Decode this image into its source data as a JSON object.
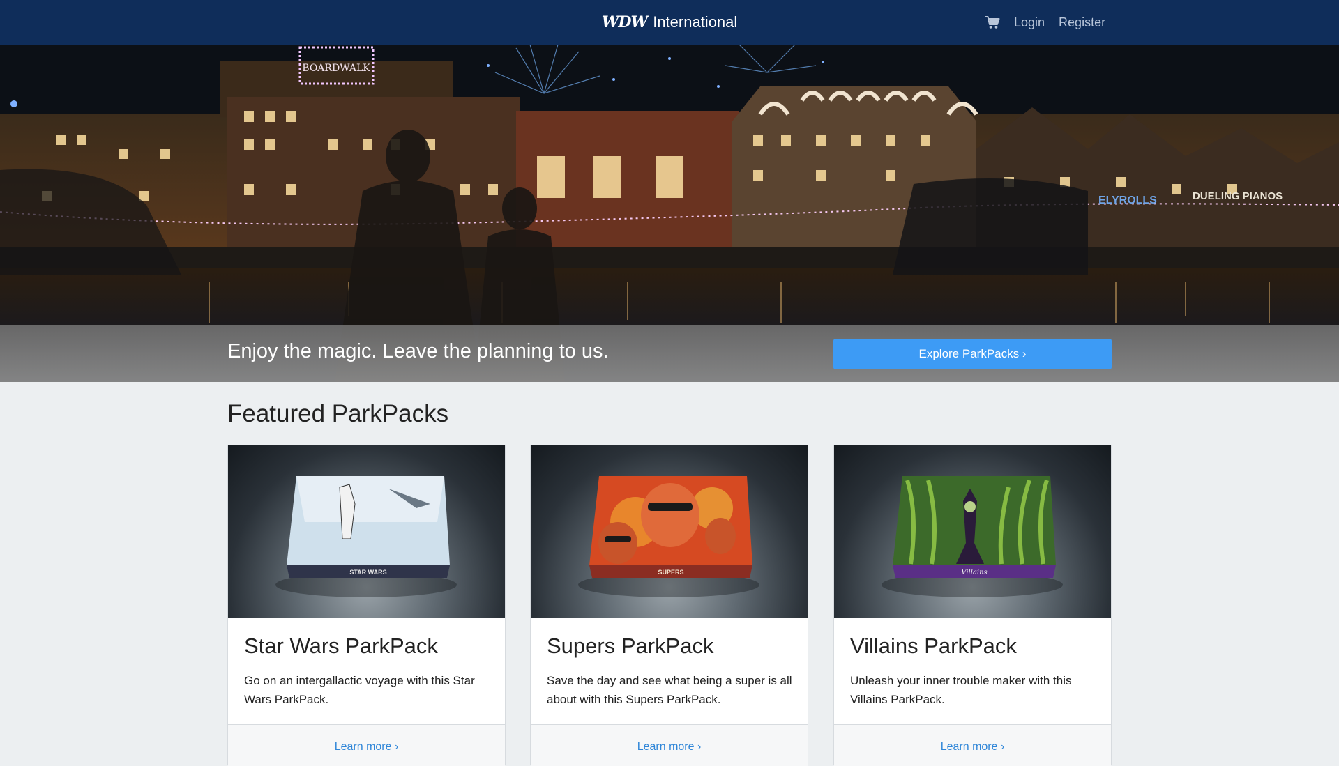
{
  "header": {
    "logo_text": "WDW",
    "brand_name": "International",
    "cart_icon": "shopping-cart-icon",
    "login_label": "Login",
    "register_label": "Register"
  },
  "hero": {
    "tagline": "Enjoy the magic. Leave the planning to us.",
    "cta_label": "Explore ParkPacks ›",
    "signs": [
      "The Boardwalk",
      "DUELING PIANOS",
      "ELYROLLS"
    ]
  },
  "featured": {
    "title": "Featured ParkPacks",
    "cards": [
      {
        "title": "Star Wars ParkPack",
        "description": "Go on an intergallactic voyage with this Star Wars ParkPack.",
        "box_label": "STAR WARS",
        "link_label": "Learn more ›",
        "accent": "#3a3f55"
      },
      {
        "title": "Supers ParkPack",
        "description": "Save the day and see what being a super is all about with this Supers ParkPack.",
        "box_label": "SUPERS",
        "link_label": "Learn more ›",
        "accent": "#8b2d22"
      },
      {
        "title": "Villains ParkPack",
        "description": "Unleash your inner trouble maker with this Villains ParkPack.",
        "box_label": "Villains",
        "link_label": "Learn more ›",
        "accent": "#5a2f86"
      }
    ]
  },
  "colors": {
    "nav_bg": "#0f2d5a",
    "cta_bg": "#3d9bf5",
    "link": "#2f86d8",
    "page_bg": "#eceff1"
  }
}
